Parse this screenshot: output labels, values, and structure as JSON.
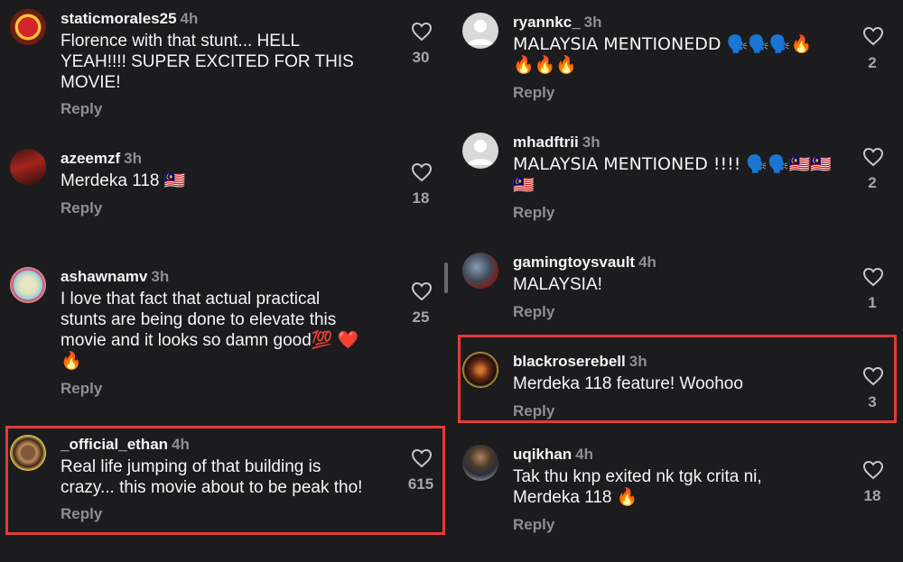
{
  "reply_label": "Reply",
  "comments_left": [
    {
      "user": "staticmorales25",
      "time": "4h",
      "lines": [
        "Florence with that stunt... HELL",
        "YEAH!!!! SUPER EXCITED FOR THIS",
        "MOVIE!"
      ],
      "likes": "30"
    },
    {
      "user": "azeemzf",
      "time": "3h",
      "lines": [
        "Merdeka 118 🇲🇾"
      ],
      "likes": "18"
    },
    {
      "user": "ashawnamv",
      "time": "3h",
      "lines": [
        "I love that fact that actual practical",
        "stunts are being done to elevate this",
        "movie and it looks so damn good💯 ❤️",
        "🔥"
      ],
      "likes": "25"
    },
    {
      "user": "_official_ethan",
      "time": "4h",
      "lines": [
        "Real life jumping of that building is",
        "crazy... this movie about to be peak tho!"
      ],
      "likes": "615"
    }
  ],
  "comments_right": [
    {
      "user": "ryannkc_",
      "time": "3h",
      "lines": [
        "MALAYSIA MENTIONEDD 🗣️🗣️🗣️🔥",
        "🔥🔥🔥"
      ],
      "likes": "2"
    },
    {
      "user": "mhadftrii",
      "time": "3h",
      "lines": [
        "MALAYSIA MENTIONED !!!! 🗣️🗣️🇲🇾🇲🇾",
        "🇲🇾"
      ],
      "likes": "2"
    },
    {
      "user": "gamingtoysvault",
      "time": "4h",
      "lines": [
        "MALAYSIA!"
      ],
      "likes": "1"
    },
    {
      "user": "blackroserebell",
      "time": "3h",
      "lines": [
        "Merdeka 118 feature! Woohoo"
      ],
      "likes": "3"
    },
    {
      "user": "uqikhan",
      "time": "4h",
      "lines": [
        "Tak thu knp exited nk tgk crita ni,",
        "Merdeka 118 🔥"
      ],
      "likes": "18"
    }
  ],
  "colors": {
    "background": "#1c1c1e",
    "highlight": "#e23b3b",
    "secondary_text": "#8e8e93"
  }
}
